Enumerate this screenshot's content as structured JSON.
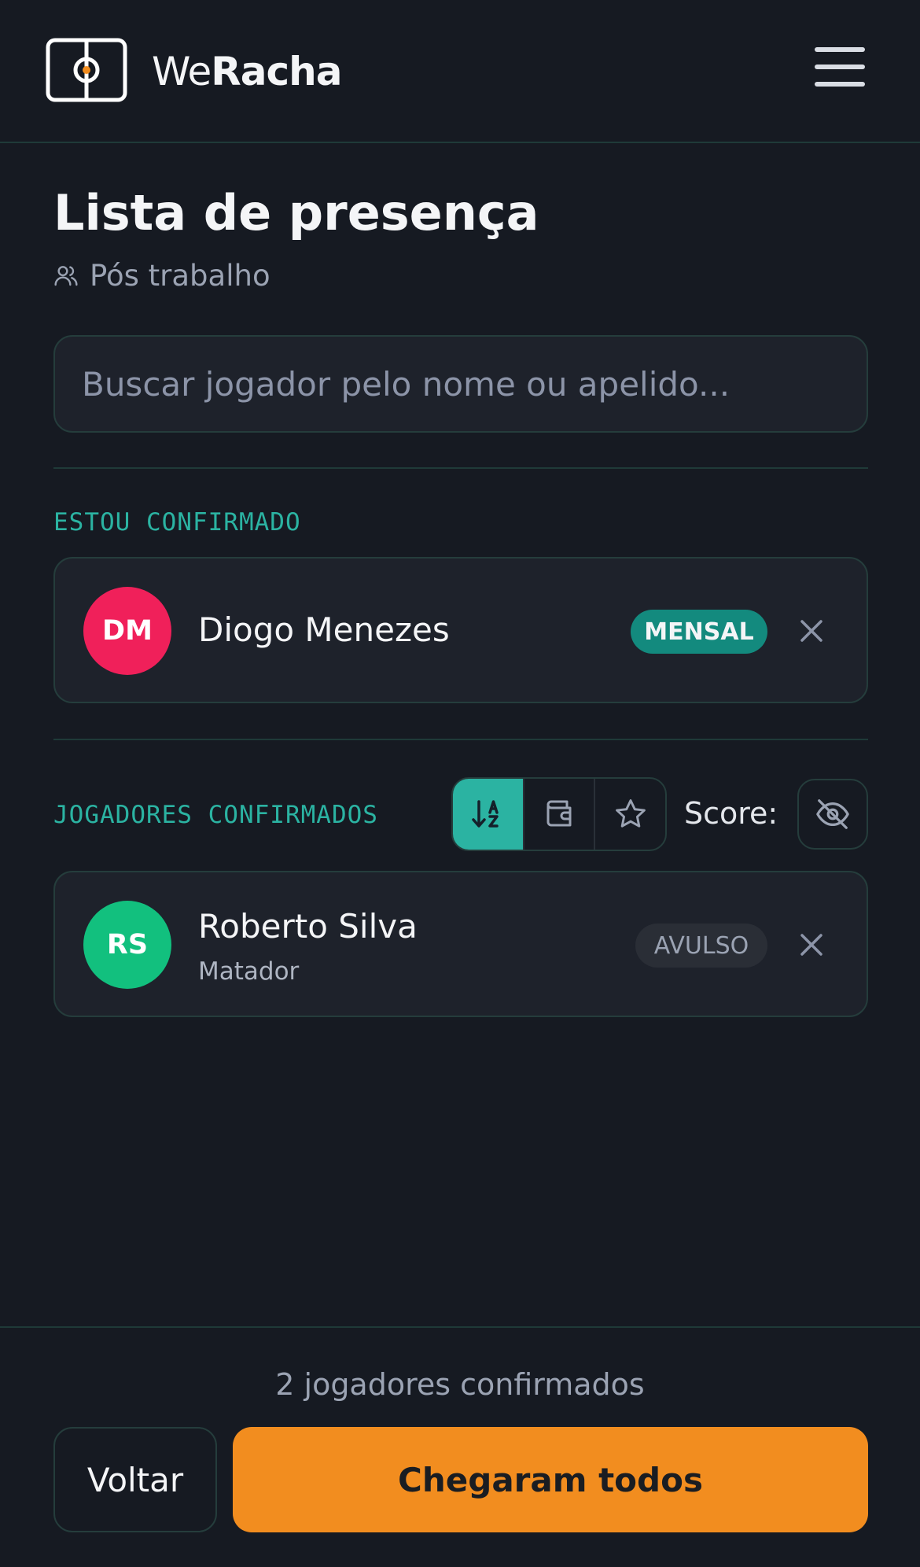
{
  "header": {
    "brand_we": "We",
    "brand_racha": "Racha",
    "icons": {
      "logo": "field-logo-icon",
      "menu": "hamburger-menu-icon"
    }
  },
  "page": {
    "title": "Lista de presença",
    "group_name": "Pós trabalho",
    "group_icon": "users-icon"
  },
  "search": {
    "placeholder": "Buscar jogador pelo nome ou apelido..."
  },
  "me_section": {
    "label": "ESTOU CONFIRMADO",
    "player": {
      "initials": "DM",
      "name": "Diogo Menezes",
      "badge": "MENSAL",
      "avatar_color": "#f0205a",
      "badge_color": "#138a7e"
    }
  },
  "confirmed_section": {
    "label": "JOGADORES CONFIRMADOS",
    "sort_buttons": [
      {
        "icon": "sort-alpha-icon",
        "active": true
      },
      {
        "icon": "wallet-icon",
        "active": false
      },
      {
        "icon": "star-icon",
        "active": false
      }
    ],
    "score_label": "Score:",
    "score_toggle_icon": "eye-off-icon",
    "players": [
      {
        "initials": "RS",
        "name": "Roberto Silva",
        "nickname": "Matador",
        "badge": "AVULSO",
        "avatar_color": "#12c07e",
        "badge_color": "#2a2e36"
      }
    ]
  },
  "footer": {
    "count_text": "2 jogadores confirmados",
    "back_label": "Voltar",
    "all_arrived_label": "Chegaram todos"
  },
  "colors": {
    "background": "#161a22",
    "accent_teal": "#2bb3a2",
    "accent_orange": "#f28d1f"
  }
}
